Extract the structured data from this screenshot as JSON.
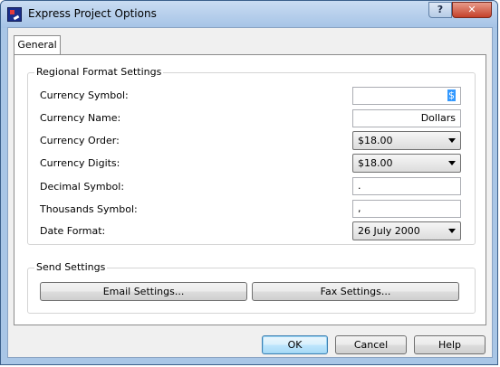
{
  "window": {
    "title": "Express Project Options",
    "help_glyph": "?",
    "close_glyph": "✕"
  },
  "tabs": [
    {
      "label": "General"
    }
  ],
  "regional": {
    "title": "Regional Format Settings",
    "currency_symbol_label": "Currency Symbol:",
    "currency_symbol_value": "$",
    "currency_name_label": "Currency Name:",
    "currency_name_value": "Dollars",
    "currency_order_label": "Currency Order:",
    "currency_order_value": "$18.00",
    "currency_digits_label": "Currency Digits:",
    "currency_digits_value": "$18.00",
    "decimal_symbol_label": "Decimal Symbol:",
    "decimal_symbol_value": ".",
    "thousands_symbol_label": "Thousands Symbol:",
    "thousands_symbol_value": ",",
    "date_format_label": "Date Format:",
    "date_format_value": "26 July 2000"
  },
  "send": {
    "title": "Send Settings",
    "email_button": "Email Settings...",
    "fax_button": "Fax Settings..."
  },
  "footer": {
    "ok": "OK",
    "cancel": "Cancel",
    "help": "Help"
  },
  "icons": {
    "app": "app-icon",
    "dropdown": "chevron-down-icon"
  },
  "colors": {
    "selection": "#3399ff",
    "title_bar": "#a5c3e6",
    "close_button": "#c5412a"
  }
}
